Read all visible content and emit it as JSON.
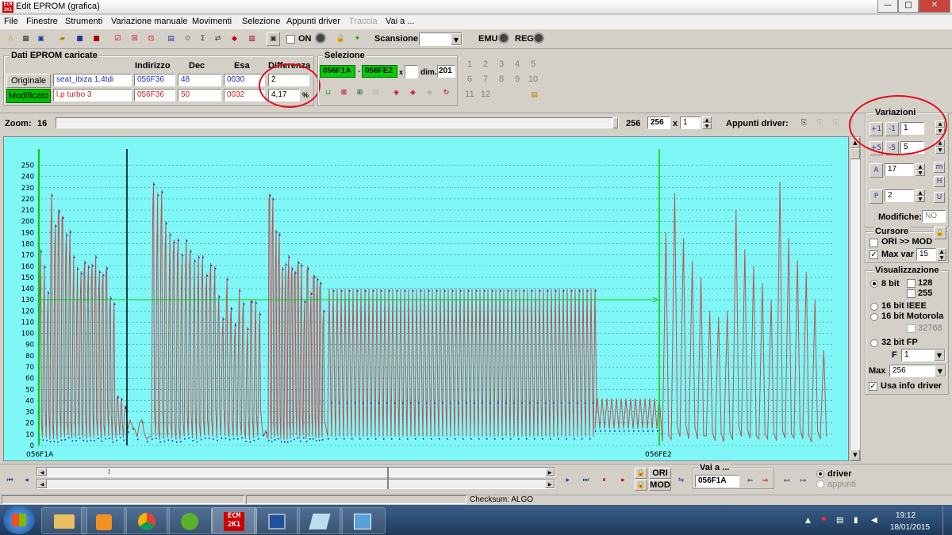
{
  "window": {
    "title": "Edit EPROM (grafica)",
    "min": "—",
    "max": "□",
    "close": "✕"
  },
  "menu": [
    "File",
    "Finestre",
    "Strumenti",
    "Variazione manuale",
    "Movimenti",
    "Selezione",
    "Appunti driver",
    "Traccia",
    "Vai a ..."
  ],
  "toolbar": {
    "on_label": "ON",
    "scansione_label": "Scansione",
    "emu_label": "EMU",
    "reg_label": "REG"
  },
  "dati": {
    "group_title": "Dati EPROM caricate",
    "headers": {
      "indirizzo": "Indirizzo",
      "dec": "Dec",
      "esa": "Esa",
      "differenza": "Differenza"
    },
    "originale": {
      "button": "Originale",
      "name": "seat_ibiza 1.4tdi",
      "indirizzo": "056F36",
      "dec": "48",
      "esa": "0030",
      "diff": "2"
    },
    "modificato": {
      "button": "Modificato",
      "name": "l.p turbo 3",
      "indirizzo": "056F36",
      "dec": "50",
      "esa": "0032",
      "diff": "4,17",
      "pct": "%"
    }
  },
  "selezione": {
    "group_title": "Selezione",
    "start": "056F1A",
    "sep": "-",
    "end": "056FE2",
    "x": "x",
    "dim_label": "dim.",
    "dim": "201"
  },
  "numpad": [
    "1",
    "2",
    "3",
    "4",
    "5",
    "6",
    "7",
    "8",
    "9",
    "10",
    "11",
    "12"
  ],
  "zoom": {
    "label": "Zoom:",
    "min": "16",
    "max": "256",
    "value": "256",
    "x": "x",
    "factor": "1"
  },
  "appunti": {
    "label": "Appunti driver:"
  },
  "variazioni": {
    "title": "Variazioni",
    "v1": "1",
    "v2": "5",
    "a": "17",
    "p": "2",
    "modifiche_label": "Modifiche:",
    "modifiche_value": "NO"
  },
  "cursore": {
    "title": "Cursore",
    "ori_mod": "ORI >> MOD",
    "maxvar_label": "Max var",
    "maxvar": "15"
  },
  "visualizzazione": {
    "title": "Visualizzazione",
    "bit8": "8 bit",
    "c128": "128",
    "c255": "255",
    "bit16ieee": "16 bit IEEE",
    "bit16mot": "16 bit Motorola",
    "c32768": "32768",
    "bit32fp": "32 bit FP",
    "f_label": "F",
    "f_value": "1",
    "max_label": "Max",
    "max_value": "256",
    "usa_info": "Usa info driver"
  },
  "nav": {
    "ori": "ORI",
    "mod": "MOD",
    "vai_title": "Vai a ...",
    "vai_value": "056F1A",
    "driver": "driver",
    "appunti": "appunti"
  },
  "status": {
    "checksum": "Checksum: ALGO"
  },
  "taskbar": {
    "time": "19:12",
    "date": "18/01/2015"
  },
  "colors": {
    "plot_bg": "#7ff7f7",
    "original_series": "#1a22cc",
    "modified_series": "#c05050",
    "marker": "#00d000",
    "highlight_circle": "#e0101a"
  },
  "chart_data": {
    "type": "line",
    "title": "",
    "xlabel": "",
    "ylabel": "",
    "ylim": [
      0,
      256
    ],
    "yticks": [
      "0",
      "10",
      "20",
      "30",
      "40",
      "50",
      "60",
      "70",
      "80",
      "90",
      "100",
      "110",
      "120",
      "130",
      "140",
      "150",
      "160",
      "170",
      "180",
      "190",
      "200",
      "210",
      "220",
      "230",
      "240",
      "250"
    ],
    "x_tick_labels": [
      "056F1A",
      "056FE2"
    ],
    "grid": true,
    "horizontal_marker": 130,
    "series": [],
    "approx_peaks": {
      "segment1": [
        175,
        225,
        205,
        170,
        165,
        170,
        160,
        45
      ],
      "segment2": [
        235,
        200,
        185,
        175,
        170,
        160,
        150,
        140,
        130
      ],
      "segment3": [
        225,
        190,
        170,
        165,
        160,
        150
      ],
      "periodic_block_peak": 140,
      "low_block_peak": 42,
      "segment_right": [
        190,
        225,
        185,
        165,
        150,
        120,
        115,
        120,
        210,
        175,
        160,
        145,
        130,
        235,
        185,
        165,
        155,
        130,
        85
      ]
    }
  }
}
